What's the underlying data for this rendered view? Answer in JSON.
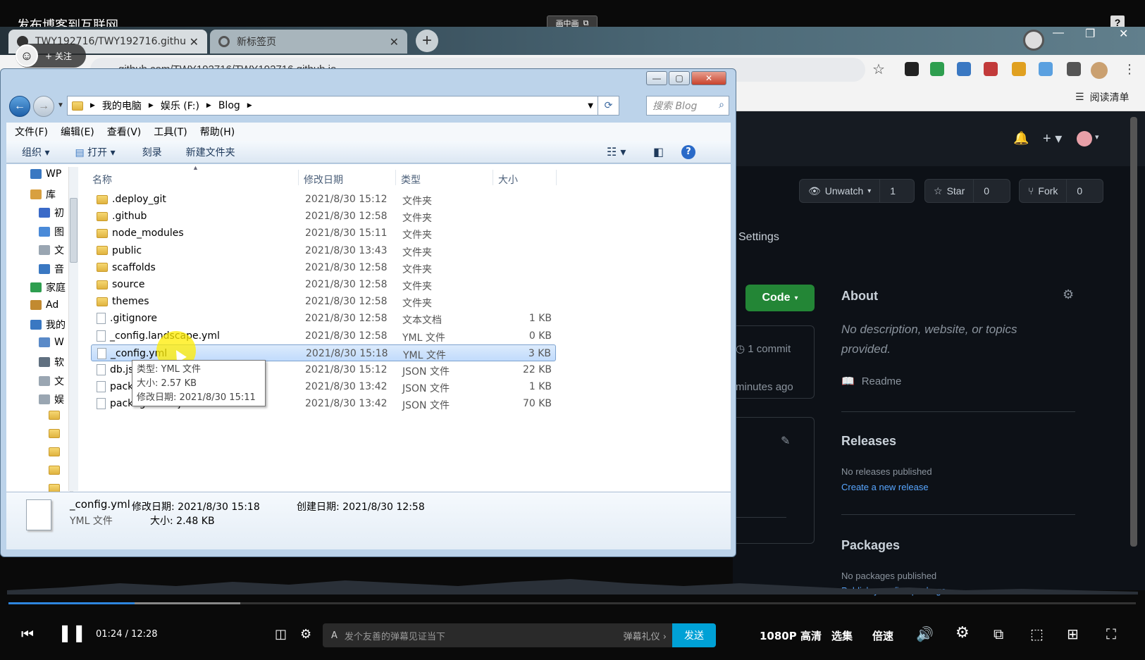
{
  "video": {
    "title": "发布博客到互联网",
    "pip_label": "画中画",
    "help": "?"
  },
  "uploader": {
    "follow": "+ 关注"
  },
  "chrome": {
    "tabs": [
      {
        "label": "TWY192716/TWY192716.githu",
        "close": "✕"
      },
      {
        "label": "新标签页",
        "close": "✕"
      }
    ],
    "newtab": "+",
    "url": "github.com/TWY192716/TWY192716.github.io",
    "reading_list": "阅读清单",
    "ext_colors": [
      "#222222",
      "#2e9e4f",
      "#3a78c2",
      "#c23a3a",
      "#e0a020",
      "#5aa0e0",
      "#555555",
      "#caa070"
    ]
  },
  "github": {
    "unwatch": {
      "label": "Unwatch",
      "count": "1"
    },
    "star": {
      "label": "Star",
      "count": "0"
    },
    "fork": {
      "label": "Fork",
      "count": "0"
    },
    "settings_tab": "Settings",
    "code_btn": "Code",
    "about_title": "About",
    "about_desc": "No description, website, or topics provided.",
    "readme": "Readme",
    "commit": "1 commit",
    "minutes_ago": "minutes ago",
    "releases_title": "Releases",
    "releases_sub": "No releases published",
    "releases_link": "Create a new release",
    "packages_title": "Packages",
    "packages_sub": "No packages published",
    "packages_link": "Publish your first package"
  },
  "explorer": {
    "breadcrumb": [
      "我的电脑",
      "娱乐 (F:)",
      "Blog"
    ],
    "search_placeholder": "搜索 Blog",
    "menu": [
      "文件(F)",
      "编辑(E)",
      "查看(V)",
      "工具(T)",
      "帮助(H)"
    ],
    "cmd": {
      "organize": "组织",
      "open": "打开",
      "burn": "刻录",
      "new_folder": "新建文件夹"
    },
    "nav_items": [
      "WP",
      "库",
      "初",
      "图",
      "文",
      "音",
      "家庭",
      "Ad",
      "我的",
      "W",
      "软",
      "文",
      "娱"
    ],
    "columns": {
      "name": "名称",
      "date": "修改日期",
      "type": "类型",
      "size": "大小"
    },
    "files": [
      {
        "name": ".deploy_git",
        "date": "2021/8/30 15:12",
        "type": "文件夹",
        "size": "",
        "kind": "folder"
      },
      {
        "name": ".github",
        "date": "2021/8/30 12:58",
        "type": "文件夹",
        "size": "",
        "kind": "folder"
      },
      {
        "name": "node_modules",
        "date": "2021/8/30 15:11",
        "type": "文件夹",
        "size": "",
        "kind": "folder"
      },
      {
        "name": "public",
        "date": "2021/8/30 13:43",
        "type": "文件夹",
        "size": "",
        "kind": "folder"
      },
      {
        "name": "scaffolds",
        "date": "2021/8/30 12:58",
        "type": "文件夹",
        "size": "",
        "kind": "folder"
      },
      {
        "name": "source",
        "date": "2021/8/30 12:58",
        "type": "文件夹",
        "size": "",
        "kind": "folder"
      },
      {
        "name": "themes",
        "date": "2021/8/30 12:58",
        "type": "文件夹",
        "size": "",
        "kind": "folder"
      },
      {
        "name": ".gitignore",
        "date": "2021/8/30 12:58",
        "type": "文本文档",
        "size": "1 KB",
        "kind": "file"
      },
      {
        "name": "_config.landscape.yml",
        "date": "2021/8/30 12:58",
        "type": "YML 文件",
        "size": "0 KB",
        "kind": "file"
      },
      {
        "name": "_config.yml",
        "date": "2021/8/30 15:18",
        "type": "YML 文件",
        "size": "3 KB",
        "kind": "file",
        "selected": true
      },
      {
        "name": "db.json",
        "date": "2021/8/30 15:12",
        "type": "JSON 文件",
        "size": "22 KB",
        "kind": "file"
      },
      {
        "name": "package.json",
        "date": "2021/8/30 13:42",
        "type": "JSON 文件",
        "size": "1 KB",
        "kind": "file"
      },
      {
        "name": "package-lock.json",
        "date": "2021/8/30 13:42",
        "type": "JSON 文件",
        "size": "70 KB",
        "kind": "file"
      }
    ],
    "tooltip": {
      "type": "类型: YML 文件",
      "size": "大小: 2.57 KB",
      "modified": "修改日期: 2021/8/30 15:11"
    },
    "details": {
      "filename": "_config.yml",
      "filetype": "YML 文件",
      "modified_label": "修改日期: 2021/8/30 15:18",
      "size_label": "大小: 2.48 KB",
      "created_label": "创建日期: 2021/8/30 12:58"
    }
  },
  "player": {
    "time": "01:24 / 12:28",
    "danmaku_placeholder": "发个友善的弹幕见证当下",
    "danmaku_etiquette": "弹幕礼仪 ›",
    "send": "发送",
    "quality": "1080P 高清",
    "episodes": "选集",
    "speed": "倍速",
    "progress_fraction": 0.112
  }
}
